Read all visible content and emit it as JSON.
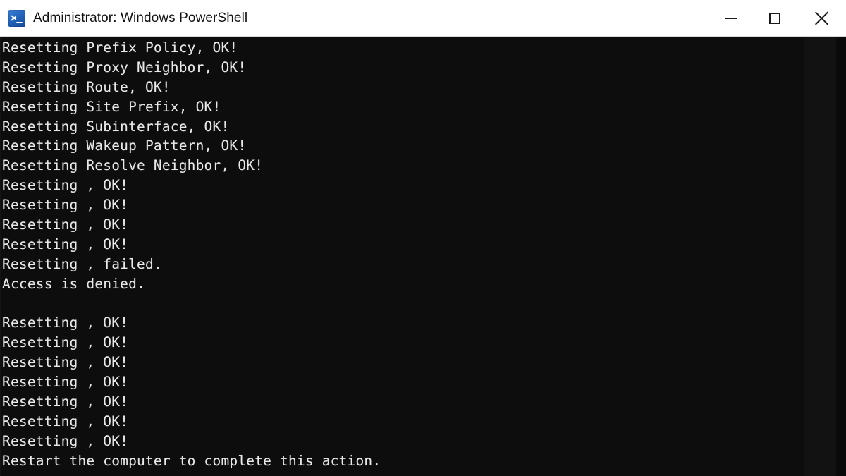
{
  "window": {
    "title": "Administrator: Windows PowerShell",
    "app_icon": "powershell-icon",
    "titlebar_bg": "#ffffff",
    "title_color": "#111111",
    "controls": {
      "minimize_label": "Minimize",
      "maximize_label": "Maximize",
      "close_label": "Close",
      "minimize_icon": "minimize-icon",
      "maximize_icon": "maximize-icon",
      "close_icon": "close-icon"
    }
  },
  "console": {
    "background": "#0d0d0d",
    "foreground": "#e9e9e9",
    "lines": [
      "Resetting Prefix Policy, OK!",
      "Resetting Proxy Neighbor, OK!",
      "Resetting Route, OK!",
      "Resetting Site Prefix, OK!",
      "Resetting Subinterface, OK!",
      "Resetting Wakeup Pattern, OK!",
      "Resetting Resolve Neighbor, OK!",
      "Resetting , OK!",
      "Resetting , OK!",
      "Resetting , OK!",
      "Resetting , OK!",
      "Resetting , failed.",
      "Access is denied.",
      "",
      "Resetting , OK!",
      "Resetting , OK!",
      "Resetting , OK!",
      "Resetting , OK!",
      "Resetting , OK!",
      "Resetting , OK!",
      "Resetting , OK!",
      "Restart the computer to complete this action."
    ]
  }
}
